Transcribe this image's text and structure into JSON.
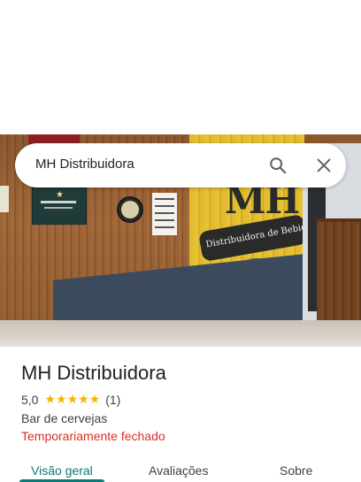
{
  "search": {
    "query": "MH Distribuidora"
  },
  "hero": {
    "sign_mh": "MH",
    "sign_ribbon": "Distribuidora de Bebidas"
  },
  "place": {
    "name": "MH Distribuidora",
    "rating": "5,0",
    "stars": "★★★★★",
    "review_count": "(1)",
    "category": "Bar de cervejas",
    "status": "Temporariamente fechado"
  },
  "tabs": [
    {
      "label": "Visão geral",
      "active": true
    },
    {
      "label": "Avaliações",
      "active": false
    },
    {
      "label": "Sobre",
      "active": false
    }
  ],
  "colors": {
    "accent": "#0b7a75",
    "status_closed": "#d93025",
    "star": "#f4b400"
  },
  "icons": [
    "search-icon",
    "close-icon"
  ]
}
